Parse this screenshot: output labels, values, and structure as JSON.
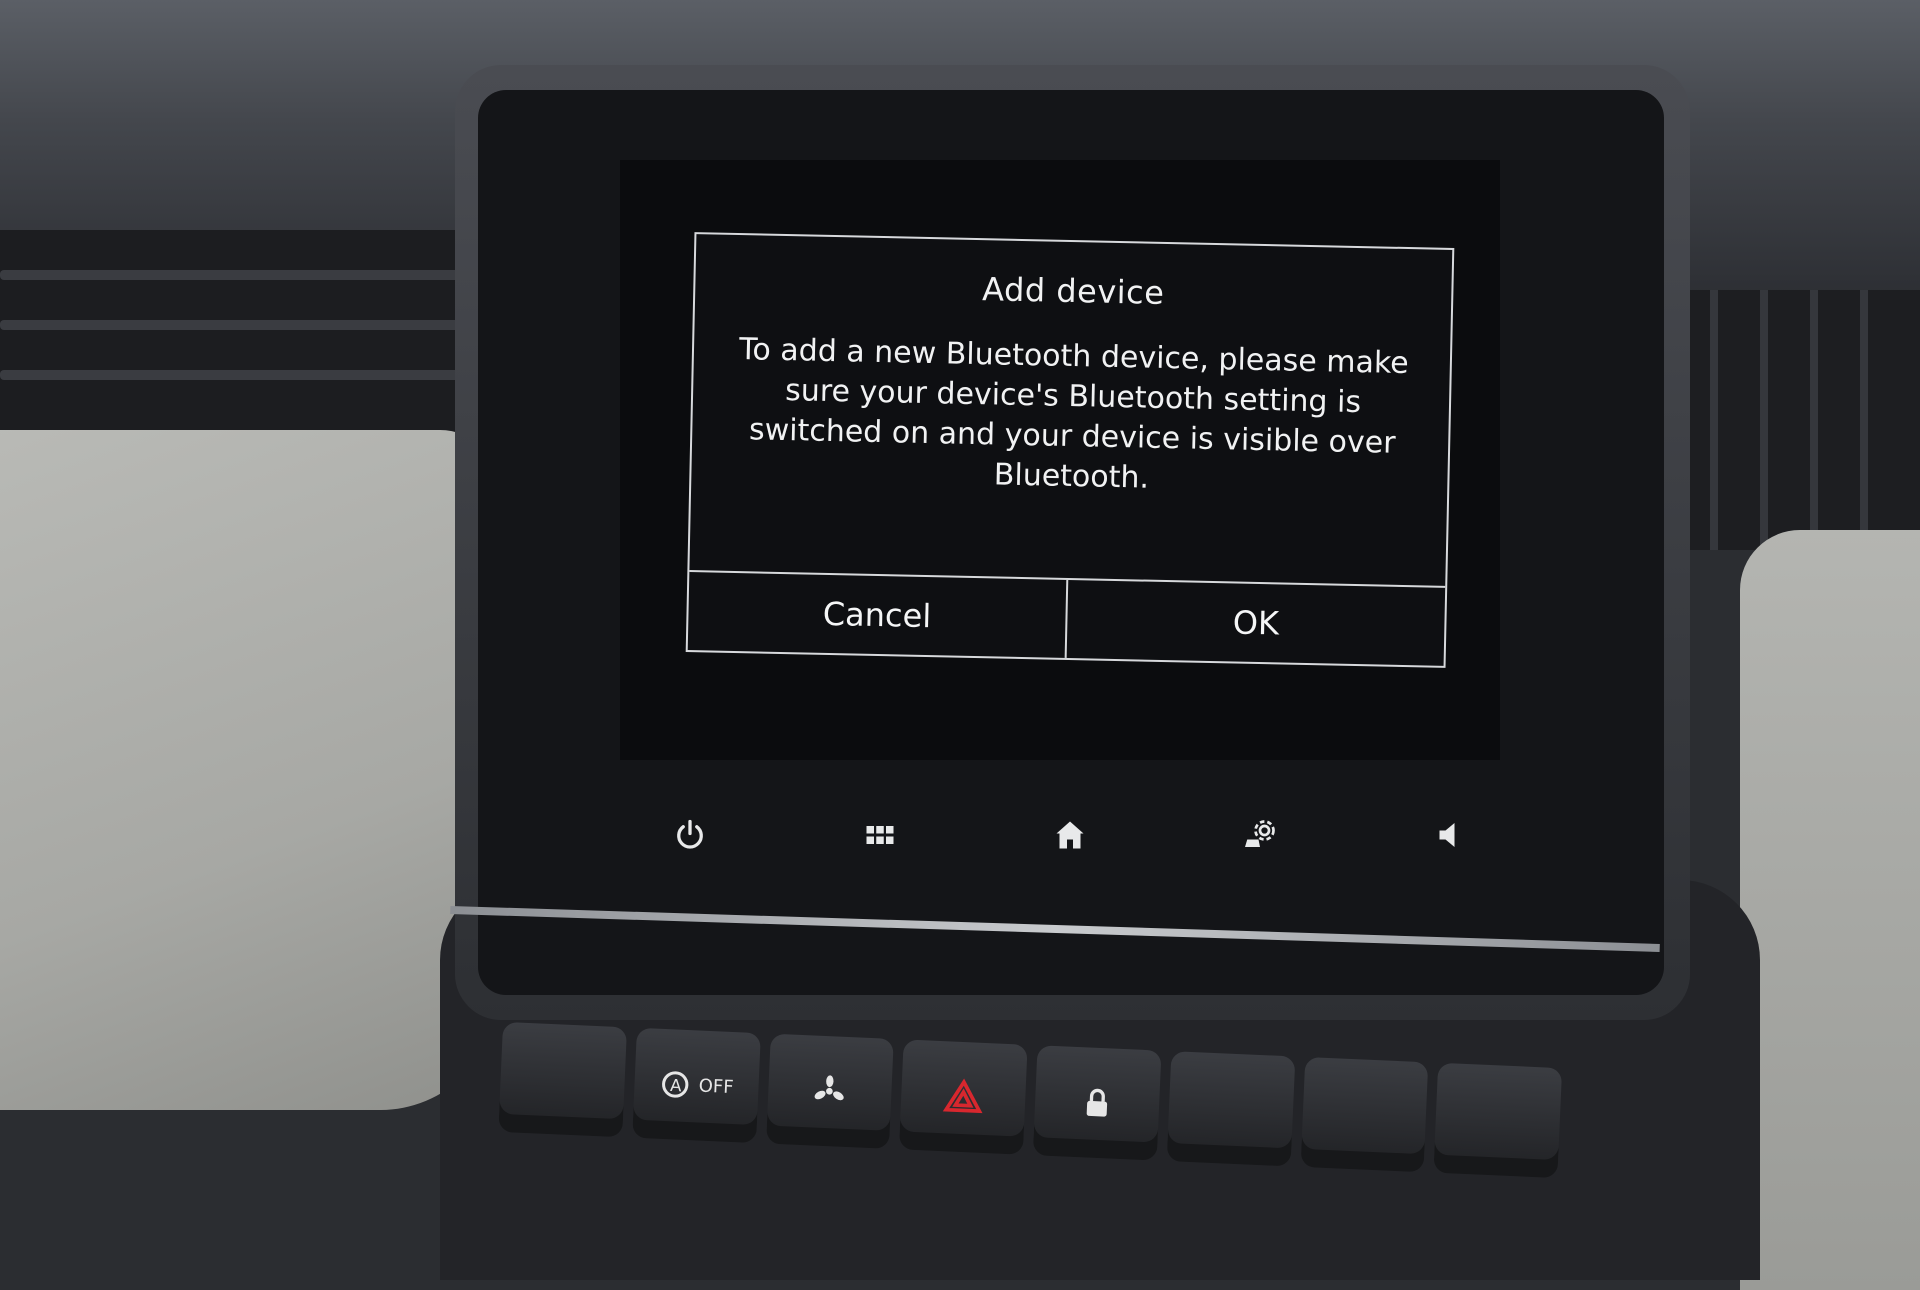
{
  "dialog": {
    "title": "Add device",
    "message": "To add a new Bluetooth device, please make sure your device's Bluetooth setting is switched on and your device is visible over Bluetooth.",
    "cancel_label": "Cancel",
    "ok_label": "OK"
  },
  "iconbar": {
    "items": [
      {
        "icon": "power-icon"
      },
      {
        "icon": "apps-grid-icon"
      },
      {
        "icon": "home-icon"
      },
      {
        "icon": "vehicle-settings-icon"
      },
      {
        "icon": "volume-icon"
      }
    ]
  },
  "hardware_buttons": [
    {
      "icon": "blank"
    },
    {
      "icon": "auto-stop-off-icon",
      "label": "OFF"
    },
    {
      "icon": "fan-icon"
    },
    {
      "icon": "hazard-icon",
      "color": "#d8272e"
    },
    {
      "icon": "lock-icon"
    },
    {
      "icon": "blank"
    },
    {
      "icon": "blank"
    },
    {
      "icon": "blank"
    }
  ],
  "colors": {
    "screen_bg": "#0b0c0e",
    "dialog_text": "#f1f2f3",
    "hazard": "#d8272e"
  }
}
